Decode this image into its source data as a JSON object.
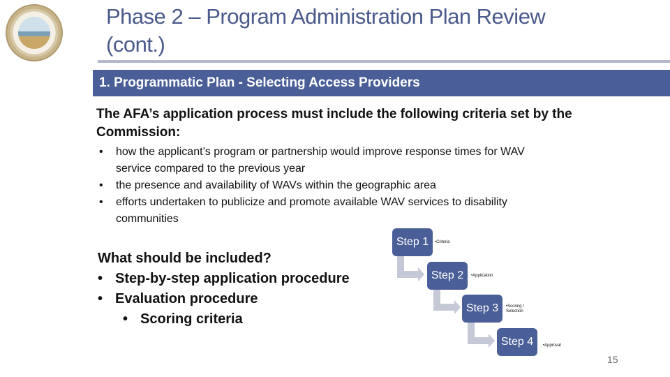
{
  "header": {
    "logo": "california-public-utilities-commission-seal",
    "title_line1": "Phase 2 – Program Administration Plan Review",
    "title_line2": "(cont.)"
  },
  "section": {
    "label": "1. Programmatic Plan - Selecting Access Providers"
  },
  "lead": {
    "line1": "The AFA’s application process must include the following criteria set by the",
    "line2": "Commission:"
  },
  "criteria": [
    {
      "line1": "how the applicant’s program or partnership would improve response times for WAV",
      "line2": "service compared to the previous year"
    },
    {
      "line1": "the presence and availability of WAVs within the geographic area",
      "line2": ""
    },
    {
      "line1": "efforts undertaken to publicize and promote available WAV services to disability",
      "line2": "communities"
    }
  ],
  "included": {
    "heading": "What should be included?",
    "items": [
      "Step-by-step application procedure",
      "Evaluation procedure"
    ],
    "subitems": [
      "Scoring criteria"
    ],
    "bullet": "•"
  },
  "steps": [
    {
      "label": "Step 1",
      "note": "•Criteria"
    },
    {
      "label": "Step 2",
      "note": "•Application"
    },
    {
      "label": "Step 3",
      "note": "•Scoring / Selection"
    },
    {
      "label": "Step 4",
      "note": "•Approval"
    }
  ],
  "page_number": "15",
  "colors": {
    "accent": "#4a5e98",
    "title": "#4a5a8c",
    "connector": "#c5c8d6"
  }
}
